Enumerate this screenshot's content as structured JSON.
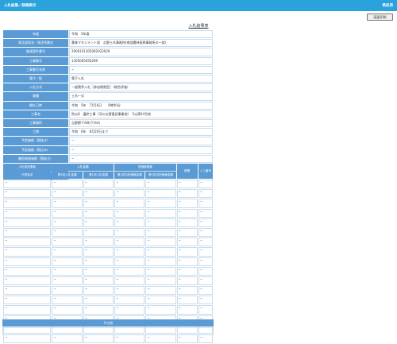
{
  "header": {
    "title": "入札結果／詳細表示",
    "right": "県民用"
  },
  "toolbar": {
    "print_label": "画面印刷"
  },
  "page": {
    "title": "入札結果表"
  },
  "info": [
    {
      "label": "年度",
      "value": "令和　5年度"
    },
    {
      "label": "発注部局名／発注所属名",
      "value": "農林マネジメント部　吉野土木事務所(南部農林振興事務所の一部)"
    },
    {
      "label": "調達案件番号",
      "value": "2900101305002023029"
    },
    {
      "label": "工事番号",
      "value": "1305005050299"
    },
    {
      "label": "工事番号名称",
      "value": "−"
    },
    {
      "label": "電子／紙",
      "value": "電子入札"
    },
    {
      "label": "入札方式",
      "value": "一般競争入札［参加制限型］（総合評価）"
    },
    {
      "label": "業種",
      "value": "土木一式"
    },
    {
      "label": "開札日時",
      "value": "令和　5年　7月16日　　9時00分"
    },
    {
      "label": "工事名",
      "value": "防災ⅲ　護岸工事（河川災害復旧事業他）　5災第24号他"
    },
    {
      "label": "工事場所",
      "value": "吉野郡下市町下市内"
    },
    {
      "label": "工期",
      "value": "令和　6年　8月20日まで"
    },
    {
      "label": "予定価格（税抜き）",
      "value": "−"
    },
    {
      "label": "予定価格（税込み）",
      "value": "−"
    },
    {
      "label": "最低制限価格（税抜き）",
      "value": "−"
    },
    {
      "label": "最低制限価格（税込み）",
      "value": "−"
    },
    {
      "label": "摘要",
      "value": "−"
    }
  ],
  "bid": {
    "h1": [
      "入札参加業者",
      "入札金額",
      "低価格調査",
      "摘要",
      "くじ番号"
    ],
    "h2": [
      "代表者名",
      "第1回入札金額",
      "第1回入札金額",
      "第1回当初価格金額",
      "第1回当初価格金額"
    ],
    "dash": "−"
  },
  "other": {
    "label": "その他"
  }
}
